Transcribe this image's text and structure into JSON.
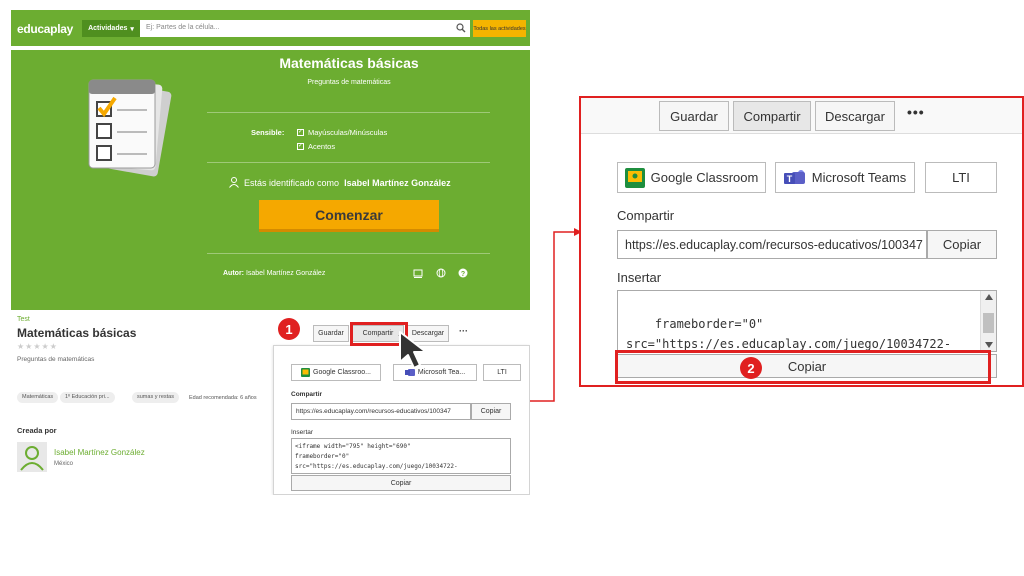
{
  "topbar": {
    "logo": "educaplay",
    "activities_label": "Actividades",
    "search_placeholder": "Ej: Partes de la célula...",
    "all_activities_label": "Todas las actividades"
  },
  "hero": {
    "title": "Matemáticas básicas",
    "subtitle": "Preguntas de matemáticas",
    "sensible_label": "Sensible:",
    "sensible_options": [
      "Mayúsculas/Minúsculas",
      "Acentos"
    ],
    "identified_prefix": "Estás identificado como",
    "identified_user": "Isabel Martínez González",
    "start_button": "Comenzar",
    "author_prefix": "Autor:",
    "author_name": "Isabel Martínez González"
  },
  "activity": {
    "breadcrumb": "Test",
    "title": "Matemáticas básicas",
    "stars": "★★★★★",
    "subtitle": "Preguntas de matemáticas",
    "tags": [
      "Matemáticas",
      "1º Educación pri...",
      "sumas y restas"
    ],
    "age": "Edad recomendada: 6 años",
    "created_by_label": "Creada por",
    "creator_name": "Isabel Martínez González",
    "creator_country": "México"
  },
  "share_small": {
    "buttons": [
      "Guardar",
      "Compartir",
      "Descargar"
    ],
    "more": "···",
    "services": [
      "Google Classroo...",
      "Microsoft Tea...",
      "LTI"
    ],
    "share_label": "Compartir",
    "share_url": "https://es.educaplay.com/recursos-educativos/100347",
    "copy_label": "Copiar",
    "insert_label": "Insertar",
    "embed_code": "<iframe width=\"795\" height=\"690\"\nframeborder=\"0\"\nsrc=\"https://es.educaplay.com/juego/10034722-",
    "copy2_label": "Copiar"
  },
  "share_zoom": {
    "buttons": [
      "Guardar",
      "Compartir",
      "Descargar"
    ],
    "more": "•••",
    "services": [
      "Google Classroom",
      "Microsoft Teams",
      "LTI"
    ],
    "share_label": "Compartir",
    "share_url": "https://es.educaplay.com/recursos-educativos/100347",
    "copy_label": "Copiar",
    "insert_label": "Insertar",
    "embed_code": "frameborder=\"0\"\nsrc=\"https://es.educaplay.com/juego/10034722-\nmatematicas_basicas.html\"></iframe>",
    "copy2_label": "Copiar"
  },
  "annotations": {
    "step1": "1",
    "step2": "2"
  },
  "colors": {
    "brand_green": "#6cad31",
    "accent_orange": "#f5a800",
    "highlight_red": "#e02020"
  }
}
